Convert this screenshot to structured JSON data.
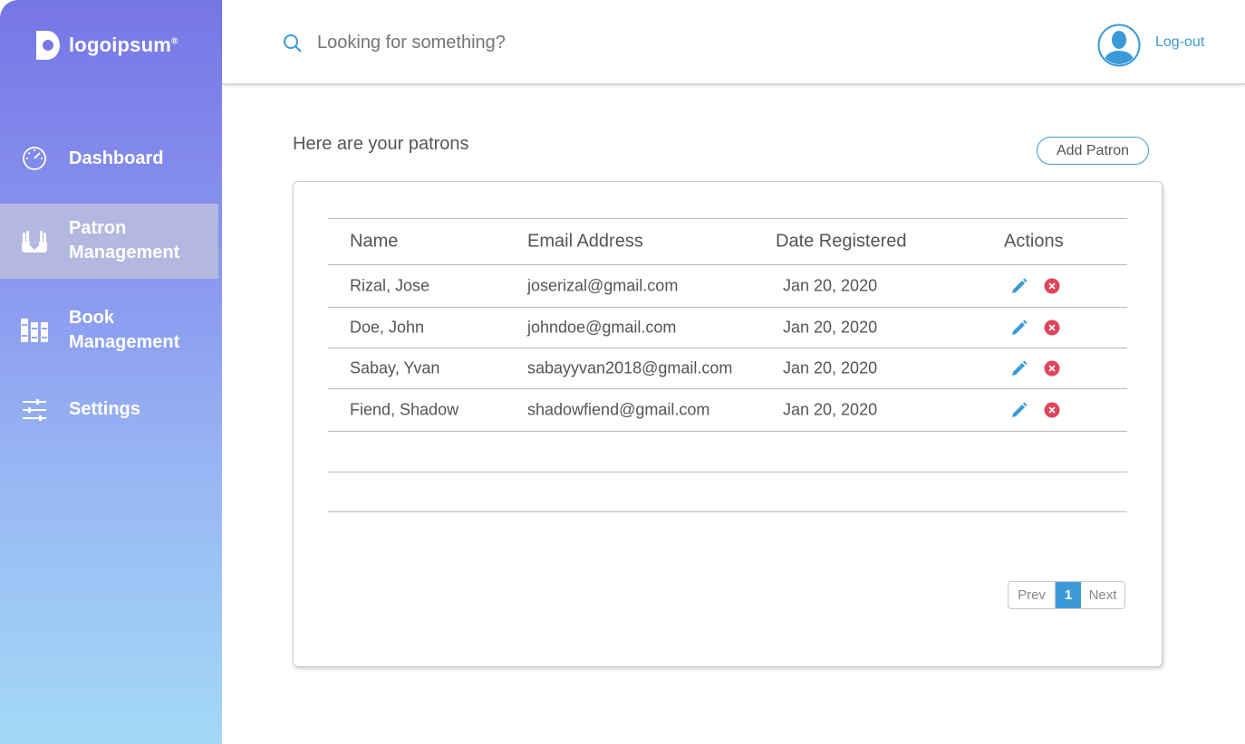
{
  "brand": {
    "name": "logoipsum",
    "mark": "®"
  },
  "sidebar": {
    "items": [
      {
        "line1": "Dashboard",
        "line2": "",
        "icon": "speedometer-icon"
      },
      {
        "line1": "Patron",
        "line2": "Management",
        "icon": "hands-heart-icon",
        "active": true
      },
      {
        "line1": "Book",
        "line2": "Management",
        "icon": "books-icon"
      },
      {
        "line1": "Settings",
        "line2": "",
        "icon": "sliders-icon"
      }
    ]
  },
  "header": {
    "search_placeholder": "Looking for something?",
    "logout_label": "Log-out"
  },
  "main": {
    "heading": "Here are your patrons",
    "add_button": "Add Patron",
    "table": {
      "columns": [
        "Name",
        "Email Address",
        "Date Registered",
        "Actions"
      ],
      "rows": [
        {
          "name": "Rizal, Jose",
          "email": "joserizal@gmail.com",
          "date": "Jan 20, 2020"
        },
        {
          "name": "Doe, John",
          "email": "johndoe@gmail.com",
          "date": "Jan 20, 2020"
        },
        {
          "name": "Sabay, Yvan",
          "email": "sabayyvan2018@gmail.com",
          "date": "Jan 20, 2020"
        },
        {
          "name": "Fiend, Shadow",
          "email": "shadowfiend@gmail.com",
          "date": "Jan 20, 2020"
        }
      ]
    },
    "pagination": {
      "prev": "Prev",
      "current": "1",
      "next": "Next"
    }
  },
  "colors": {
    "accent": "#3a9ad9",
    "danger": "#e0445a",
    "sidebar_top": "#7676e6",
    "sidebar_bottom": "#a3d9f6"
  }
}
